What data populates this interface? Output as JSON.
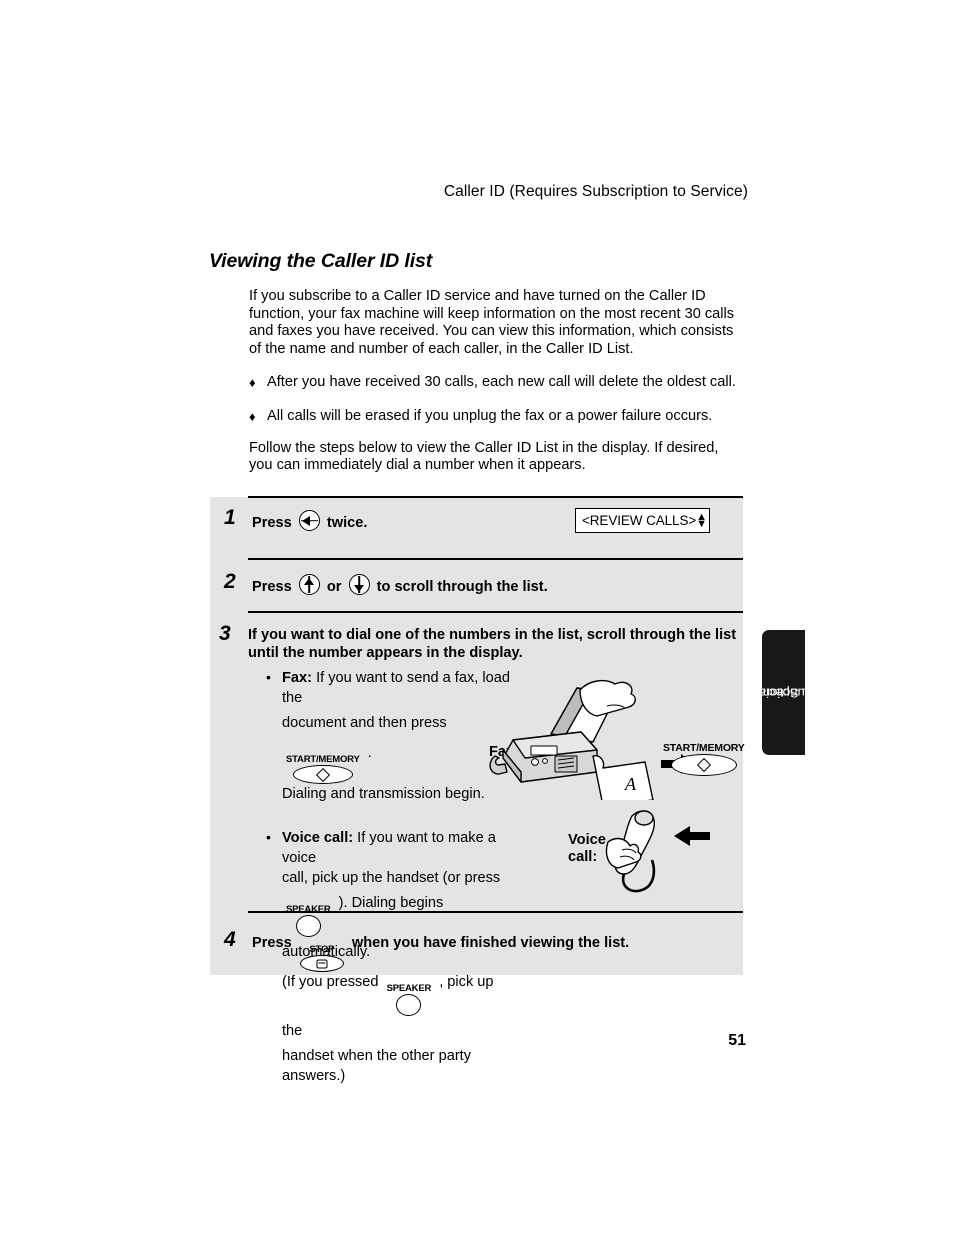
{
  "running_head": "Caller ID (Requires Subscription to Service)",
  "section_title": "Viewing the Caller ID list",
  "intro": {
    "paragraph1": "If you subscribe to a Caller ID service and have turned on the Caller ID function, your fax machine will keep information on the most recent 30 calls and faxes you have received. You can view this information, which consists of the name and number of each caller, in the Caller ID List.",
    "bullet_marker": "♦",
    "bullets": [
      "After you have received 30 calls, each new call will delete the oldest call.",
      "All calls will be erased if you unplug the fax or a power failure occurs."
    ],
    "paragraph2": "Follow the steps below to view the Caller ID List in the display. If desired, you can immediately dial a number when it appears."
  },
  "steps": {
    "step1": {
      "number": "1",
      "press_label": "Press",
      "key": "left-arrow-key",
      "after": "twice."
    },
    "step2": {
      "number": "2",
      "press_label": "Press",
      "key_up": "up-arrow-key",
      "or_label": "or",
      "key_down": "down-arrow-key",
      "after": "to  scroll through the list."
    },
    "step3": {
      "number": "3",
      "lead": "If you want to dial one of the numbers in the list, scroll through the list until the number appears in the display.",
      "bullet_marker": "•",
      "fax_bullet": {
        "label": "Fax:",
        "line1": " If you want to send a fax, load the",
        "line2": "document and then press",
        "line2_tail": ".",
        "line3": "Dialing and transmission begin.",
        "key_caption": "START/MEMORY"
      },
      "voice_bullet": {
        "label": "Voice call:",
        "line1": " If you want to make a voice",
        "line2": "call, pick up the handset (or press",
        "line3_tail": "). Dialing begins automatically.",
        "line4_head": "(If you pressed",
        "line4_tail": ", pick up the",
        "line5": "handset when the other party answers.)",
        "key_caption": "SPEAKER"
      }
    },
    "step4": {
      "number": "4",
      "press_label": "Press",
      "key_caption": "STOP",
      "after": "when you have finished viewing the list."
    }
  },
  "display": {
    "text": "<REVIEW CALLS>",
    "arrow_up": "▲",
    "arrow_down": "▼"
  },
  "illustration": {
    "fax_label": "Fax:",
    "voice_label_line1": "Voice",
    "voice_label_line2": "call:",
    "start_memory_caption": "START/MEMORY"
  },
  "side_tab": {
    "line1": "5. Special",
    "line2": "Functions"
  },
  "folio": "51",
  "colors": {
    "panel_gray": "#e4e4e4",
    "tab_black": "#181818",
    "text": "#000000"
  }
}
